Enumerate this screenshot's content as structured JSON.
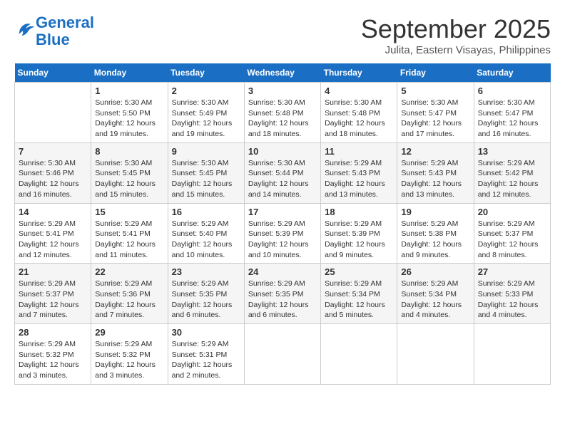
{
  "logo": {
    "line1": "General",
    "line2": "Blue"
  },
  "title": "September 2025",
  "subtitle": "Julita, Eastern Visayas, Philippines",
  "headers": [
    "Sunday",
    "Monday",
    "Tuesday",
    "Wednesday",
    "Thursday",
    "Friday",
    "Saturday"
  ],
  "weeks": [
    [
      {
        "day": "",
        "info": ""
      },
      {
        "day": "1",
        "info": "Sunrise: 5:30 AM\nSunset: 5:50 PM\nDaylight: 12 hours\nand 19 minutes."
      },
      {
        "day": "2",
        "info": "Sunrise: 5:30 AM\nSunset: 5:49 PM\nDaylight: 12 hours\nand 19 minutes."
      },
      {
        "day": "3",
        "info": "Sunrise: 5:30 AM\nSunset: 5:48 PM\nDaylight: 12 hours\nand 18 minutes."
      },
      {
        "day": "4",
        "info": "Sunrise: 5:30 AM\nSunset: 5:48 PM\nDaylight: 12 hours\nand 18 minutes."
      },
      {
        "day": "5",
        "info": "Sunrise: 5:30 AM\nSunset: 5:47 PM\nDaylight: 12 hours\nand 17 minutes."
      },
      {
        "day": "6",
        "info": "Sunrise: 5:30 AM\nSunset: 5:47 PM\nDaylight: 12 hours\nand 16 minutes."
      }
    ],
    [
      {
        "day": "7",
        "info": "Sunrise: 5:30 AM\nSunset: 5:46 PM\nDaylight: 12 hours\nand 16 minutes."
      },
      {
        "day": "8",
        "info": "Sunrise: 5:30 AM\nSunset: 5:45 PM\nDaylight: 12 hours\nand 15 minutes."
      },
      {
        "day": "9",
        "info": "Sunrise: 5:30 AM\nSunset: 5:45 PM\nDaylight: 12 hours\nand 15 minutes."
      },
      {
        "day": "10",
        "info": "Sunrise: 5:30 AM\nSunset: 5:44 PM\nDaylight: 12 hours\nand 14 minutes."
      },
      {
        "day": "11",
        "info": "Sunrise: 5:29 AM\nSunset: 5:43 PM\nDaylight: 12 hours\nand 13 minutes."
      },
      {
        "day": "12",
        "info": "Sunrise: 5:29 AM\nSunset: 5:43 PM\nDaylight: 12 hours\nand 13 minutes."
      },
      {
        "day": "13",
        "info": "Sunrise: 5:29 AM\nSunset: 5:42 PM\nDaylight: 12 hours\nand 12 minutes."
      }
    ],
    [
      {
        "day": "14",
        "info": "Sunrise: 5:29 AM\nSunset: 5:41 PM\nDaylight: 12 hours\nand 12 minutes."
      },
      {
        "day": "15",
        "info": "Sunrise: 5:29 AM\nSunset: 5:41 PM\nDaylight: 12 hours\nand 11 minutes."
      },
      {
        "day": "16",
        "info": "Sunrise: 5:29 AM\nSunset: 5:40 PM\nDaylight: 12 hours\nand 10 minutes."
      },
      {
        "day": "17",
        "info": "Sunrise: 5:29 AM\nSunset: 5:39 PM\nDaylight: 12 hours\nand 10 minutes."
      },
      {
        "day": "18",
        "info": "Sunrise: 5:29 AM\nSunset: 5:39 PM\nDaylight: 12 hours\nand 9 minutes."
      },
      {
        "day": "19",
        "info": "Sunrise: 5:29 AM\nSunset: 5:38 PM\nDaylight: 12 hours\nand 9 minutes."
      },
      {
        "day": "20",
        "info": "Sunrise: 5:29 AM\nSunset: 5:37 PM\nDaylight: 12 hours\nand 8 minutes."
      }
    ],
    [
      {
        "day": "21",
        "info": "Sunrise: 5:29 AM\nSunset: 5:37 PM\nDaylight: 12 hours\nand 7 minutes."
      },
      {
        "day": "22",
        "info": "Sunrise: 5:29 AM\nSunset: 5:36 PM\nDaylight: 12 hours\nand 7 minutes."
      },
      {
        "day": "23",
        "info": "Sunrise: 5:29 AM\nSunset: 5:35 PM\nDaylight: 12 hours\nand 6 minutes."
      },
      {
        "day": "24",
        "info": "Sunrise: 5:29 AM\nSunset: 5:35 PM\nDaylight: 12 hours\nand 6 minutes."
      },
      {
        "day": "25",
        "info": "Sunrise: 5:29 AM\nSunset: 5:34 PM\nDaylight: 12 hours\nand 5 minutes."
      },
      {
        "day": "26",
        "info": "Sunrise: 5:29 AM\nSunset: 5:34 PM\nDaylight: 12 hours\nand 4 minutes."
      },
      {
        "day": "27",
        "info": "Sunrise: 5:29 AM\nSunset: 5:33 PM\nDaylight: 12 hours\nand 4 minutes."
      }
    ],
    [
      {
        "day": "28",
        "info": "Sunrise: 5:29 AM\nSunset: 5:32 PM\nDaylight: 12 hours\nand 3 minutes."
      },
      {
        "day": "29",
        "info": "Sunrise: 5:29 AM\nSunset: 5:32 PM\nDaylight: 12 hours\nand 3 minutes."
      },
      {
        "day": "30",
        "info": "Sunrise: 5:29 AM\nSunset: 5:31 PM\nDaylight: 12 hours\nand 2 minutes."
      },
      {
        "day": "",
        "info": ""
      },
      {
        "day": "",
        "info": ""
      },
      {
        "day": "",
        "info": ""
      },
      {
        "day": "",
        "info": ""
      }
    ]
  ]
}
